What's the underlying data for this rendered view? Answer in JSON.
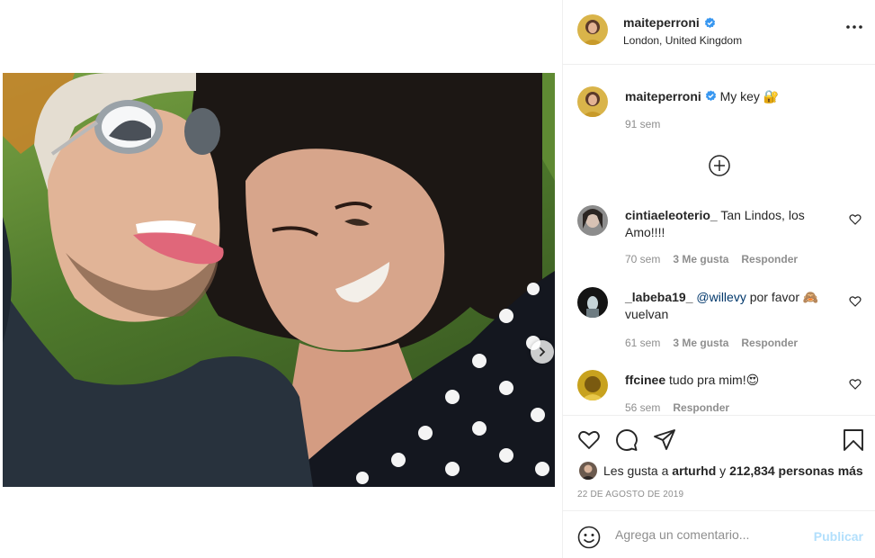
{
  "post": {
    "author": "maiteperroni",
    "location": "London, United Kingdom",
    "caption": "My key 🔐",
    "caption_age": "91 sem",
    "likes_prefix": "Les gusta a ",
    "likes_user": "arturhd",
    "likes_mid": " y ",
    "likes_count": "212,834 personas más",
    "date": "22 de agosto de 2019"
  },
  "comments": [
    {
      "user": "cintiaeleoterio_",
      "text": "Tan Lindos, los Amo!!!!",
      "mention": "",
      "age": "70 sem",
      "likes": "3 Me gusta",
      "reply": "Responder"
    },
    {
      "user": "_labeba19_",
      "mention": "@willevy",
      "text": " por favor 🙈 vuelvan",
      "age": "61 sem",
      "likes": "3 Me gusta",
      "reply": "Responder"
    },
    {
      "user": "ffcinee",
      "text": "tudo pra mim!😍",
      "mention": "",
      "age": "56 sem",
      "likes": "",
      "reply": "Responder"
    }
  ],
  "composer": {
    "placeholder": "Agrega un comentario...",
    "publish": "Publicar"
  },
  "icons": {
    "verified": "verified-badge-icon",
    "more": "more-options-icon",
    "like": "heart-icon",
    "comment": "comment-icon",
    "share": "share-icon",
    "save": "bookmark-icon",
    "emoji": "emoji-icon",
    "load": "plus-circle-icon",
    "next": "chevron-right-icon"
  },
  "colors": {
    "verified": "#3897f0",
    "publish_disabled": "#b2dffc",
    "muted": "#8e8e8e",
    "mention": "#00376b"
  }
}
